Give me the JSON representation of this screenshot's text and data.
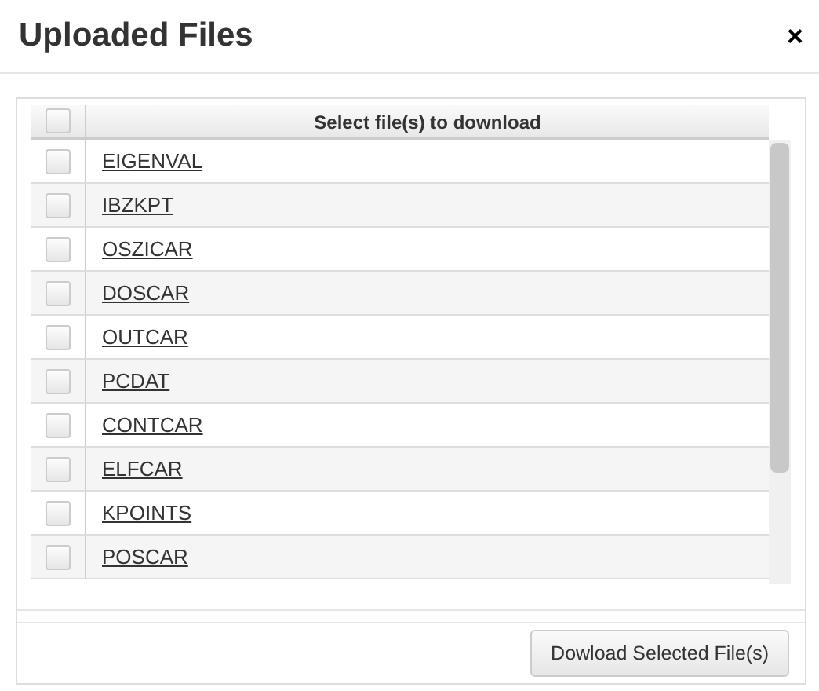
{
  "dialog": {
    "title": "Uploaded Files",
    "close": "×"
  },
  "grid": {
    "select_all": {
      "checked": false
    },
    "header": "Select file(s) to download",
    "rows": [
      {
        "name": "EIGENVAL",
        "checked": false
      },
      {
        "name": "IBZKPT",
        "checked": false
      },
      {
        "name": "OSZICAR",
        "checked": false
      },
      {
        "name": "DOSCAR",
        "checked": false
      },
      {
        "name": "OUTCAR",
        "checked": false
      },
      {
        "name": "PCDAT",
        "checked": false
      },
      {
        "name": "CONTCAR",
        "checked": false
      },
      {
        "name": "ELFCAR",
        "checked": false
      },
      {
        "name": "KPOINTS",
        "checked": false
      },
      {
        "name": "POSCAR",
        "checked": false
      }
    ]
  },
  "buttons": [
    "Dowload Selected File(s)"
  ]
}
